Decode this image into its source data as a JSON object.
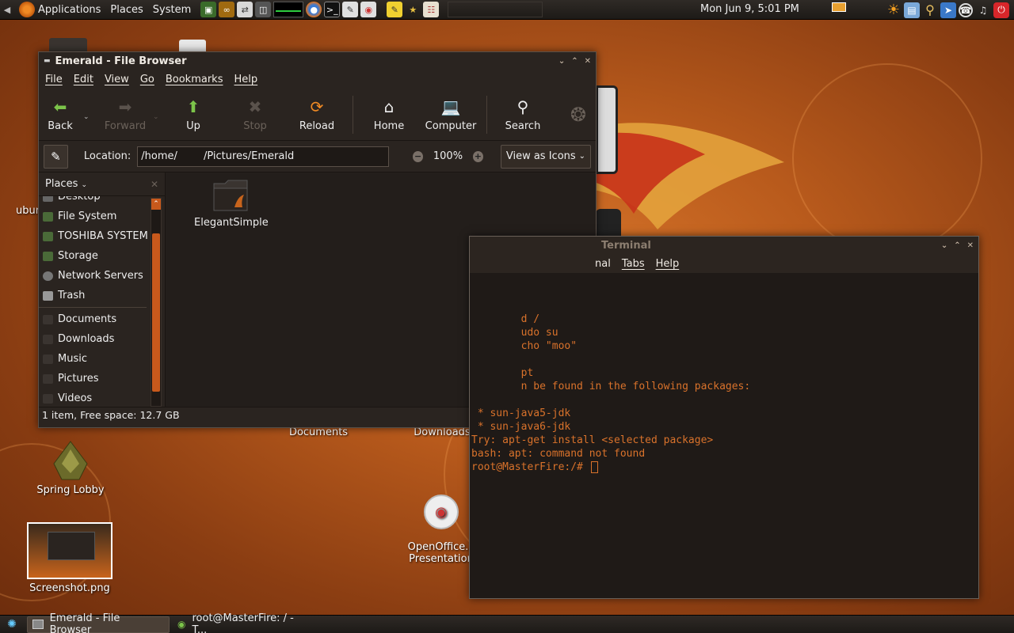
{
  "top_panel": {
    "menus": [
      "Applications",
      "Places",
      "System"
    ],
    "clock": "Mon Jun  9,  5:01 PM"
  },
  "desktop": {
    "icons": [
      {
        "label": "ubur"
      },
      {
        "label": "Documents"
      },
      {
        "label": "Downloads"
      },
      {
        "label": "Spring Lobby"
      },
      {
        "label": "OpenOffice.o\nPresentation"
      },
      {
        "label": "Screenshot.png"
      }
    ]
  },
  "file_browser": {
    "title": "Emerald - File Browser",
    "menu": [
      "File",
      "Edit",
      "View",
      "Go",
      "Bookmarks",
      "Help"
    ],
    "toolbar": {
      "back": "Back",
      "forward": "Forward",
      "up": "Up",
      "stop": "Stop",
      "reload": "Reload",
      "home": "Home",
      "computer": "Computer",
      "search": "Search"
    },
    "location_label": "Location:",
    "location_value": "/home/        /Pictures/Emerald",
    "zoom": "100%",
    "view_mode": "View as Icons",
    "sidebar": {
      "header": "Places",
      "items_places": [
        "Desktop",
        "File System",
        "TOSHIBA SYSTEM",
        "Storage",
        "Network Servers",
        "Trash"
      ],
      "items_bookmarks": [
        "Documents",
        "Downloads",
        "Music",
        "Pictures",
        "Videos"
      ]
    },
    "files": [
      {
        "name": "ElegantSimple"
      }
    ],
    "status": "1 item, Free space: 12.7 GB"
  },
  "terminal": {
    "title": "Terminal",
    "menu_partial": "nal",
    "menu": [
      "Tabs",
      "Help"
    ],
    "lines": [
      "",
      "",
      "",
      "        d /",
      "        udo su",
      "        cho \"moo\"",
      "",
      "        pt",
      "        n be found in the following packages:",
      "",
      " * sun-java5-jdk",
      " * sun-java6-jdk",
      "Try: apt-get install <selected package>",
      "bash: apt: command not found"
    ],
    "prompt": "root@MasterFire:/# "
  },
  "taskbar": {
    "tasks": [
      {
        "label": "Emerald - File Browser"
      },
      {
        "label": "root@MasterFire: / - T..."
      }
    ]
  },
  "colors": {
    "accent": "#c8591c",
    "terminal_text": "#d9722b",
    "window_bg": "#2a2420"
  }
}
